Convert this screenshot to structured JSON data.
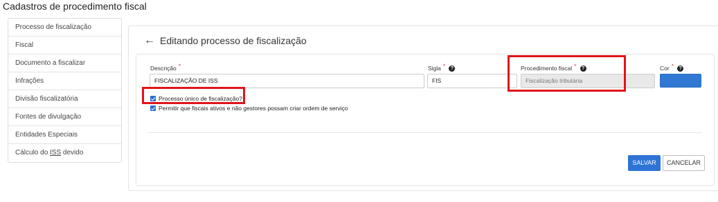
{
  "page": {
    "title": "Cadastros de procedimento fiscal"
  },
  "sidebar": {
    "items": [
      {
        "label": "Processo de fiscalização"
      },
      {
        "label": "Fiscal"
      },
      {
        "label": "Documento a fiscalizar"
      },
      {
        "label": "Infrações"
      },
      {
        "label": "Divisão fiscalizatória"
      },
      {
        "label": "Fontes de divulgação"
      },
      {
        "label": "Entidades Especiais"
      },
      {
        "label_prefix": "Cálculo do ",
        "label_underlined": "ISS",
        "label_suffix": " devido"
      }
    ]
  },
  "header": {
    "title": "Editando processo de fiscalização",
    "back_icon": "arrow-left-icon"
  },
  "form": {
    "descricao": {
      "label": "Descrição",
      "value": "FISCALIZAÇÃO DE ISS"
    },
    "sigla": {
      "label": "Sigla",
      "value": "FIS"
    },
    "procedimento": {
      "label": "Procedimento fiscal",
      "placeholder": "Fiscalização tributária"
    },
    "cor": {
      "label": "Cor",
      "value_color": "#3078d3"
    },
    "required_mark": "*",
    "help_glyph": "?",
    "checkbox_unico": {
      "label": "Processo único de fiscalização?",
      "checked": true
    },
    "checkbox_fiscais": {
      "label": "Permitir que fiscais ativos e não gestores possam criar ordem de serviço",
      "checked": true
    }
  },
  "actions": {
    "save_label": "SALVAR",
    "cancel_label": "CANCELAR"
  },
  "colors": {
    "accent": "#2d74d6",
    "highlight": "#e0141a"
  }
}
